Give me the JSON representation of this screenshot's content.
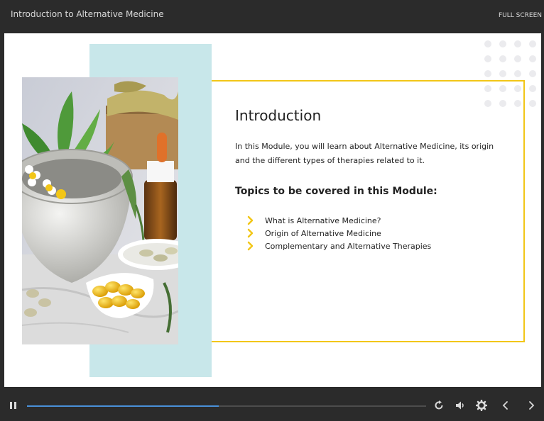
{
  "header": {
    "course_title": "Introduction to Alternative Medicine",
    "fullscreen_label": "FULL SCREEN"
  },
  "slide": {
    "heading": "Introduction",
    "intro_text": "In this Module, you will learn about Alternative Medicine, its origin and the different types of therapies related to it.",
    "topics_heading": "Topics to be covered in this Module:",
    "topics": [
      "What is Alternative Medicine?",
      "Origin of Alternative Medicine",
      "Complementary and Alternative Therapies"
    ]
  },
  "player": {
    "progress": 0.48,
    "icons": [
      "pause-icon",
      "replay-icon",
      "volume-icon",
      "settings-icon",
      "previous-icon",
      "next-icon"
    ]
  },
  "colors": {
    "player_bg": "#2b2b2b",
    "accent_yellow": "#f2c617",
    "teal_panel": "#c8e7ea",
    "progress_fill": "#4a90d9"
  }
}
